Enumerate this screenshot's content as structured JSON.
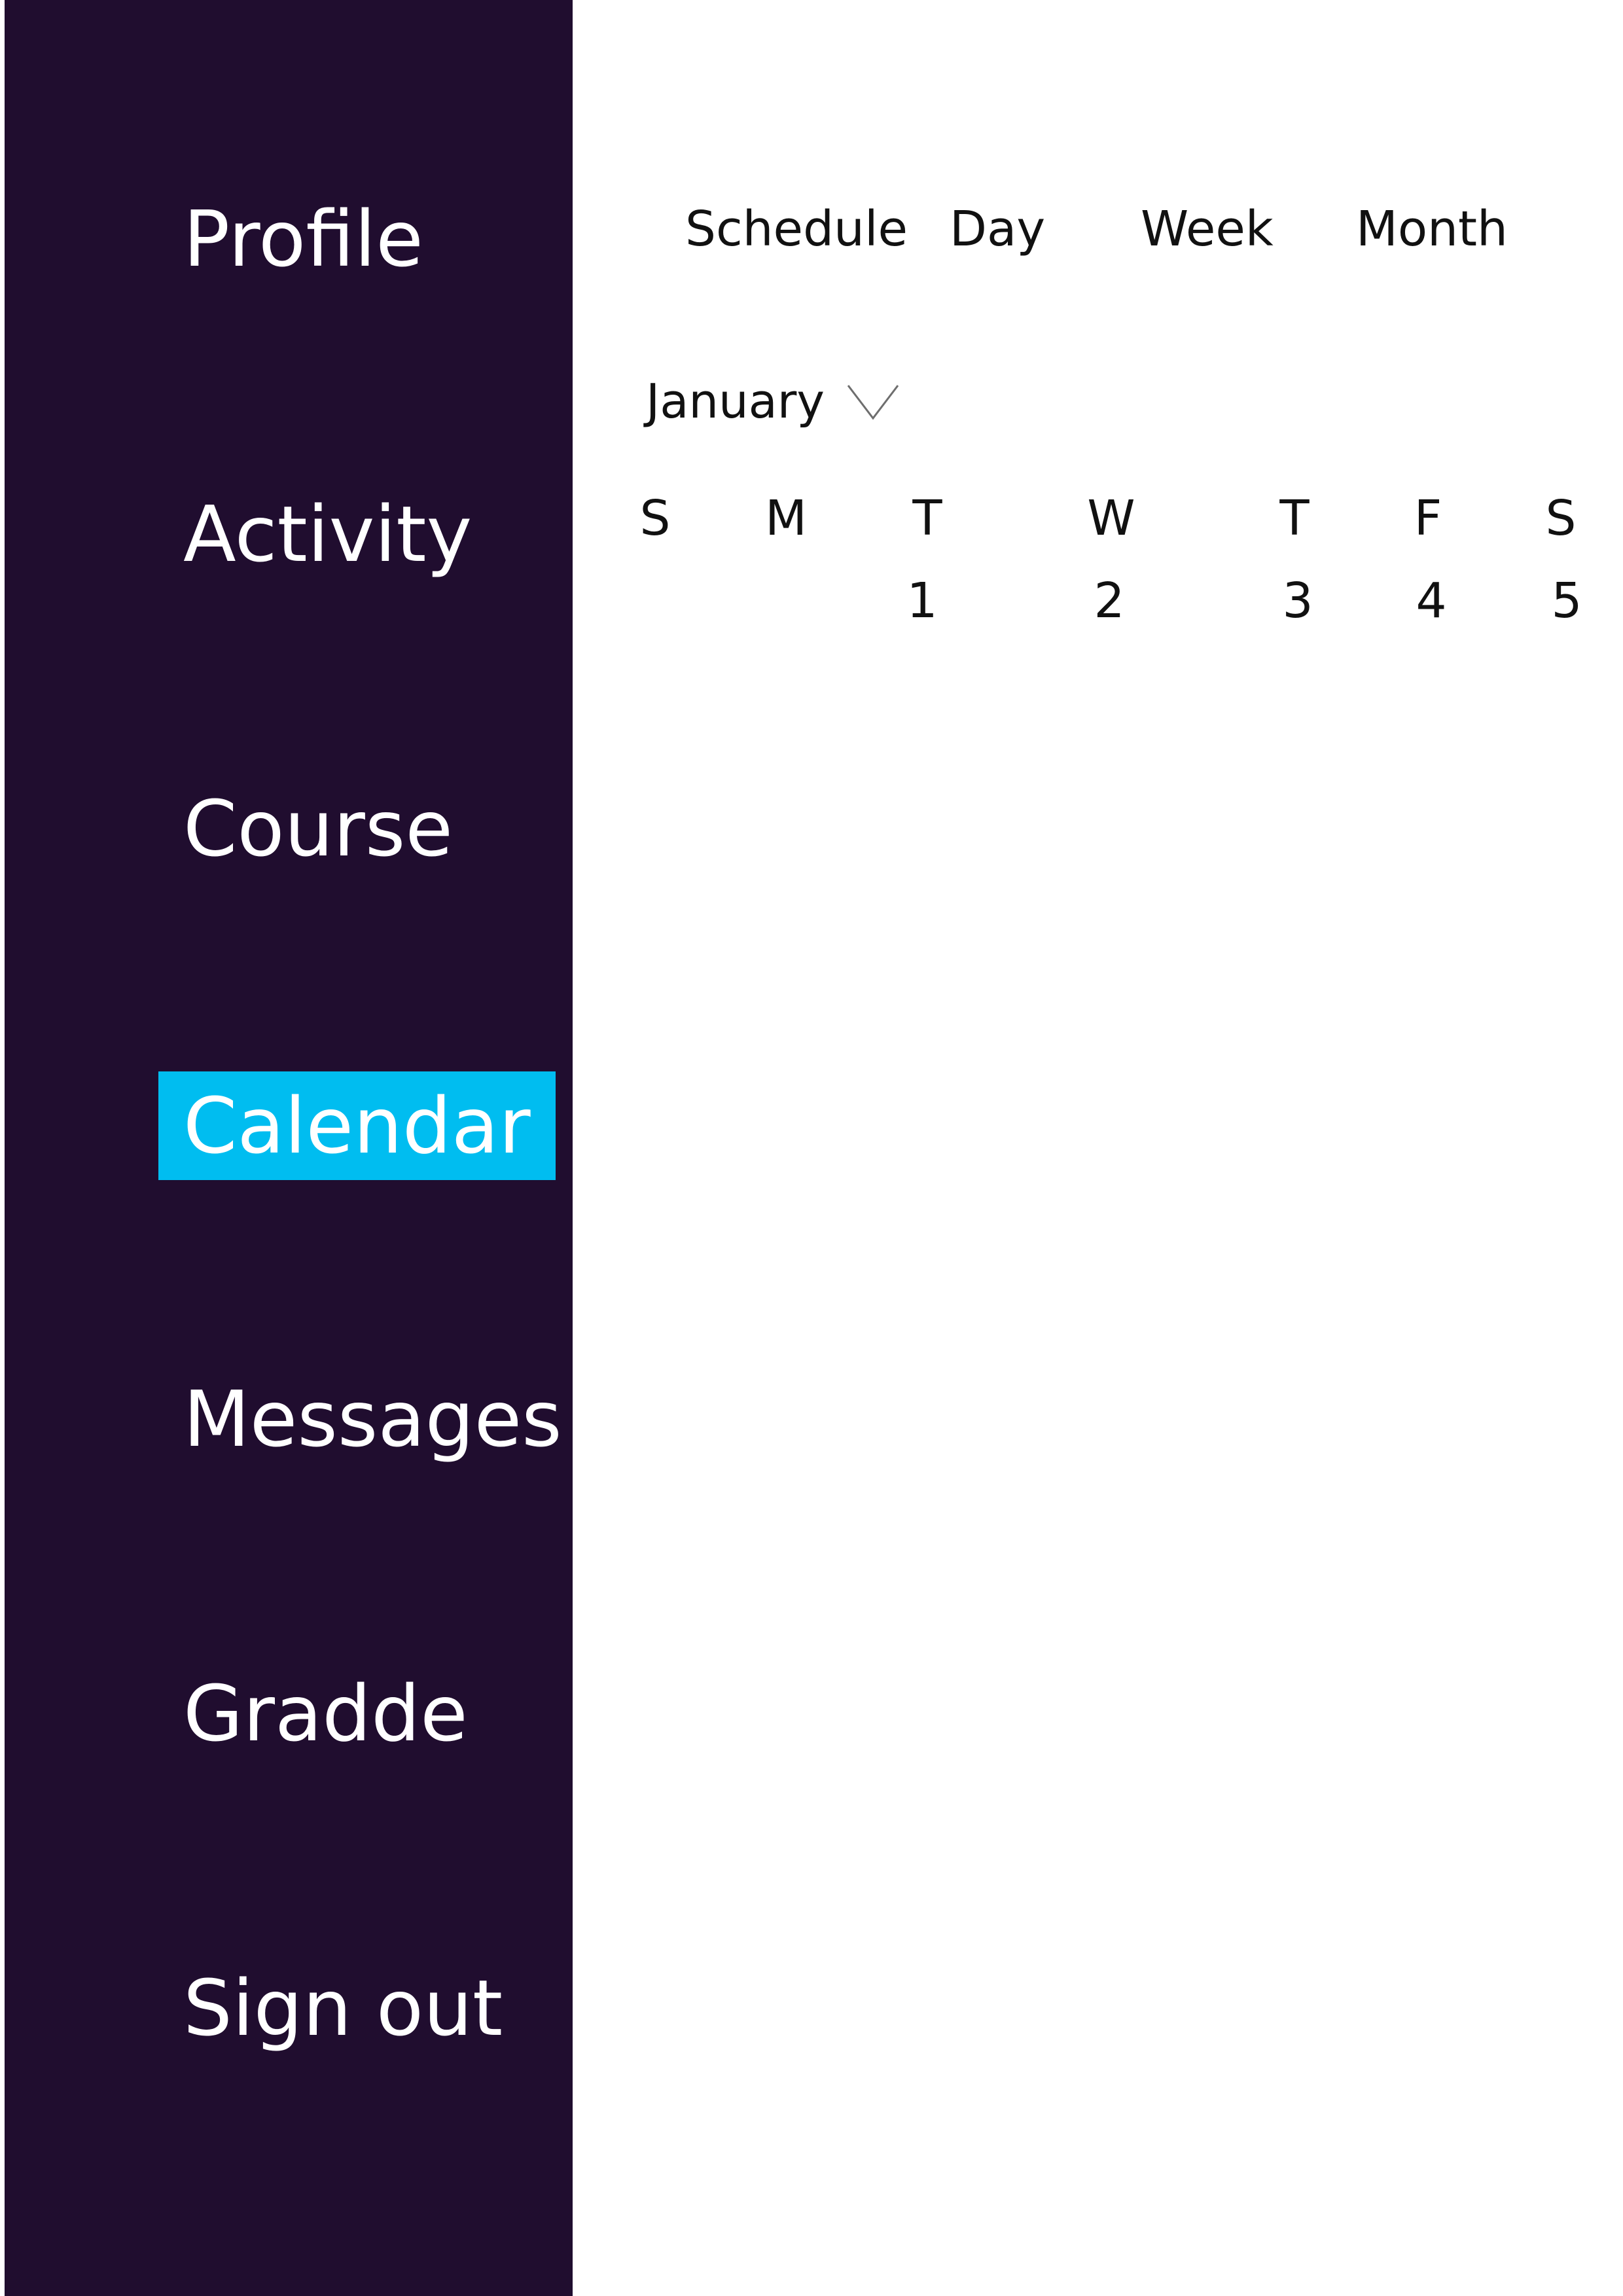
{
  "sidebar": {
    "items": [
      {
        "label": "Profile"
      },
      {
        "label": "Activity"
      },
      {
        "label": "Course"
      },
      {
        "label": "Calendar"
      },
      {
        "label": "Messages"
      },
      {
        "label": "Gradde"
      },
      {
        "label": "Sign out"
      }
    ],
    "active_index": 3
  },
  "view_tabs": [
    {
      "label": "Schedule"
    },
    {
      "label": "Day"
    },
    {
      "label": "Week"
    },
    {
      "label": "Month"
    }
  ],
  "month_picker": {
    "selected": "January",
    "icon": "chevron-down-icon"
  },
  "calendar": {
    "weekdays": [
      "S",
      "M",
      "T",
      "W",
      "T",
      "F",
      "S"
    ],
    "first_week": [
      "",
      "",
      "1",
      "2",
      "3",
      "4",
      "5"
    ]
  },
  "colors": {
    "sidebar_background": "#200d2f",
    "active_item_background": "#00bdf0",
    "sidebar_text": "#ffffff",
    "main_background": "#ffffff",
    "main_text": "#111111"
  }
}
